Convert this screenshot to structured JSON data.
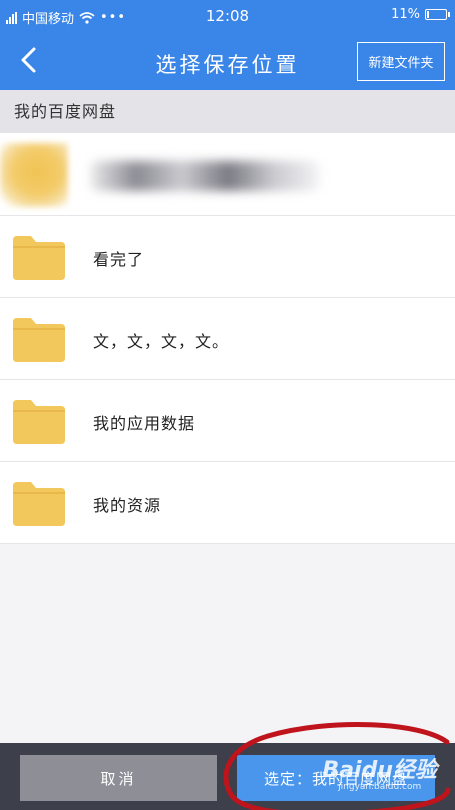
{
  "status_bar": {
    "carrier": "中国移动",
    "time": "12:08",
    "battery": "11%"
  },
  "header": {
    "title": "选择保存位置",
    "new_folder_label": "新建文件夹"
  },
  "breadcrumb": "我的百度网盘",
  "folders": [
    {
      "label": "看完了"
    },
    {
      "label": "文，文，文，文。"
    },
    {
      "label": "我的应用数据"
    },
    {
      "label": "我的资源"
    }
  ],
  "bottom_bar": {
    "cancel_label": "取消",
    "confirm_label": "选定：我的百度网盘"
  },
  "watermark": {
    "brand": "Baidu经验",
    "site": "jingyan.baidu.com"
  },
  "colors": {
    "accent": "#3a86e8",
    "folder": "#f2c75c",
    "bottom_bar": "#3d3f4a",
    "annotation": "#c0141c"
  }
}
